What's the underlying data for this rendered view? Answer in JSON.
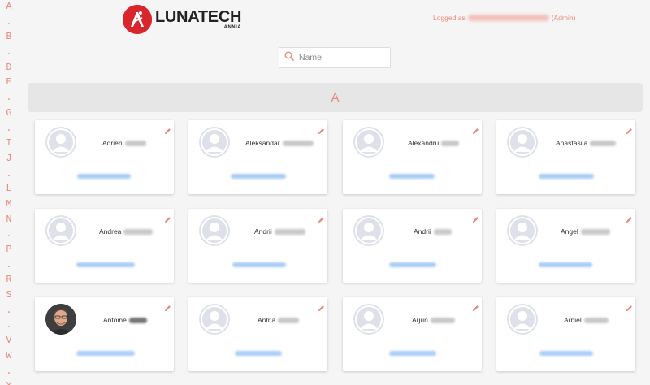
{
  "header": {
    "logo_title": "LUNATECH",
    "logo_subtitle": "ANNIA",
    "logged_as_label": "Logged as",
    "role_label": "(Admin)"
  },
  "search": {
    "placeholder": "Name"
  },
  "alphabet_index": [
    "A",
    ".",
    "B",
    ".",
    "D",
    "E",
    ".",
    "G",
    ".",
    "I",
    "J",
    ".",
    "L",
    "M",
    "N",
    ".",
    "P",
    ".",
    "R",
    "S",
    ".",
    ".",
    "V",
    "W",
    ".",
    "Y"
  ],
  "section": {
    "letter": "A"
  },
  "cards": [
    {
      "first_name": "Adrien"
    },
    {
      "first_name": "Aleksandar"
    },
    {
      "first_name": "Alexandru"
    },
    {
      "first_name": "Anastasiia"
    },
    {
      "first_name": "Andrea"
    },
    {
      "first_name": "Andrii"
    },
    {
      "first_name": "Andrii"
    },
    {
      "first_name": "Angel"
    },
    {
      "first_name": "Antoine"
    },
    {
      "first_name": "Antria"
    },
    {
      "first_name": "Arjun"
    },
    {
      "first_name": "Arniel"
    }
  ],
  "colors": {
    "accent": "#e8877a",
    "logo_red": "#d9262c",
    "section_bg": "#e6e6e6",
    "page_bg": "#f5f5f5",
    "avatar_placeholder": "#dfe1ea"
  },
  "icons": {
    "search": "search-icon",
    "edit": "pencil-icon",
    "avatar": "avatar-placeholder-icon"
  }
}
